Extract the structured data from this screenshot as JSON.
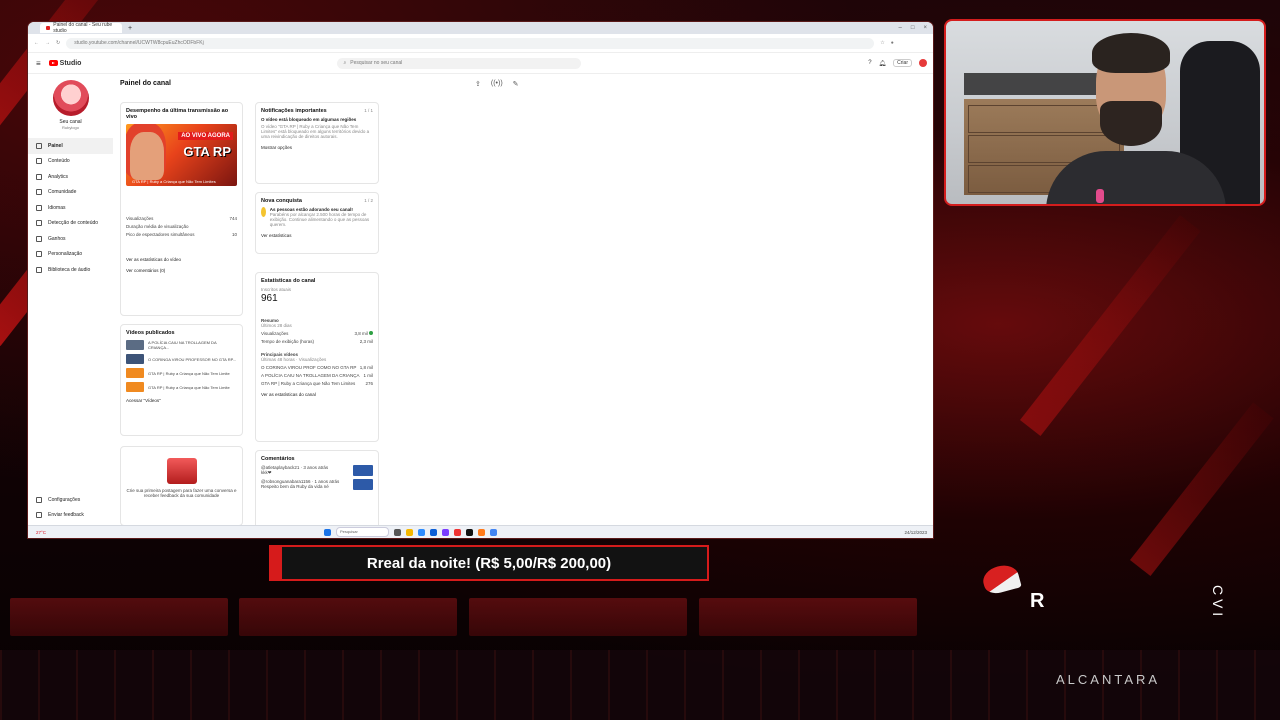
{
  "browser": {
    "tab_title": "Painel do canal - Seu rube studio",
    "url": "studio.youtube.com/channel/UCWTW8cpuEuZhcODFbFKj"
  },
  "studio": {
    "logo_text": "Studio",
    "search_placeholder": "Pesquisar no seu canal",
    "create_label": "Criar"
  },
  "sidebar": {
    "channel_title": "Seu canal",
    "channel_sub": "Rubylogo",
    "items": [
      {
        "label": "Painel"
      },
      {
        "label": "Conteúdo"
      },
      {
        "label": "Analytics"
      },
      {
        "label": "Comunidade"
      },
      {
        "label": "Idiomas"
      },
      {
        "label": "Detecção de conteúdo"
      },
      {
        "label": "Ganhos"
      },
      {
        "label": "Personalização"
      },
      {
        "label": "Biblioteca de áudio"
      }
    ],
    "bottom_items": [
      {
        "label": "Configurações"
      },
      {
        "label": "Enviar feedback"
      }
    ]
  },
  "main": {
    "page_title": "Painel do canal",
    "live_card": {
      "title": "Desempenho da última transmissão ao vivo",
      "thumb_live": "AO VIVO AGORA",
      "thumb_game": "GTA RP",
      "thumb_caption": "GTA RP | Ruby a Criança que Não Tem Limites",
      "stat_views_label": "Visualizações",
      "stat_views_value": "744",
      "stat_dur_label": "Duração média de visualização",
      "stat_peak_label": "Pico de espectadores simultâneos",
      "stat_peak_value": "10",
      "link_video": "Ver as estatísticas do vídeo",
      "link_comments": "Ver comentários (0)"
    },
    "videos_card": {
      "title": "Vídeos publicados",
      "videos": [
        {
          "title": "A POLÍCIA CAIU NA TROLLAGEM DA CRIANÇA..."
        },
        {
          "title": "O CORINGA VIROU PROFESSOR NO GTA RP..."
        },
        {
          "title": "GTA RP | Ruby a Criança que Não Tem Limite"
        },
        {
          "title": "GTA RP | Ruby a Criança que Não Tem Limite"
        }
      ],
      "link": "Acessar \"Vídeos\""
    },
    "notif_card": {
      "title": "Notificações importantes",
      "pager": "1 / 1",
      "headline": "O vídeo está bloqueado em algumas regiões",
      "body": "O vídeo \"GTA RP | Ruby a Criança que Não Tem Limites\" está bloqueado em alguns territórios devido a uma reivindicação de direitos autorais.",
      "button": "Mostrar opções"
    },
    "achieve_card": {
      "title": "Nova conquista",
      "pager": "1 / 2",
      "headline": "As pessoas estão adorando seu canal!",
      "body": "Parabéns por alcançar 2.500 horas de tempo de exibição. Continue alimentando o que as pessoas querem.",
      "button": "Ver estatísticas"
    },
    "stats_card": {
      "title": "Estatísticas do canal",
      "subs_label": "Inscritos atuais",
      "subs_value": "961",
      "summary_label": "Resumo",
      "summary_sub": "Últimos 28 dias",
      "views_label": "Visualizações",
      "views_value": "3,8 mil",
      "watch_label": "Tempo de exibição (horas)",
      "watch_value": "2,3 mil",
      "top_label": "Principais vídeos",
      "top_sub": "Últimas 48 horas · Visualizações",
      "top_videos": [
        {
          "title": "O CORINGA VIROU PROF COMO NO GTA RP",
          "views": "1,8 mil"
        },
        {
          "title": "A POLÍCIA CAIU NA TROLLAGEM DA CRIANÇA",
          "views": "1 mil"
        },
        {
          "title": "GTA RP | Ruby a Criança que Não Tem Limites",
          "views": "276"
        }
      ],
      "link": "Ver as estatísticas do canal"
    },
    "comments_card": {
      "title": "Comentários",
      "items": [
        {
          "author": "@atletaplayback21",
          "time": "3 anos atrás",
          "text": "kkk❤"
        },
        {
          "author": "@robsonguanabara1156",
          "time": "1 anos atrás",
          "text": "Respeito bem da Ruby da vida né"
        }
      ]
    },
    "empty_post_text": "Crie sua primeira postagem para fazer uma conversa e receber feedback da sua comunidade"
  },
  "taskbar": {
    "search_placeholder": "Pesquisar",
    "left_temp": "27°C",
    "date": "24/12/2023"
  },
  "overlay": {
    "goal_text": "Rreal da noite! (R$ 5,00/R$ 200,00)",
    "goal_progress": 0.025,
    "brand": "ALCANTARA",
    "letter": "R",
    "side_text": "C V I"
  },
  "colors": {
    "accent": "#d61b1b",
    "youtube_red": "#ff0000",
    "success": "#2ea043"
  }
}
